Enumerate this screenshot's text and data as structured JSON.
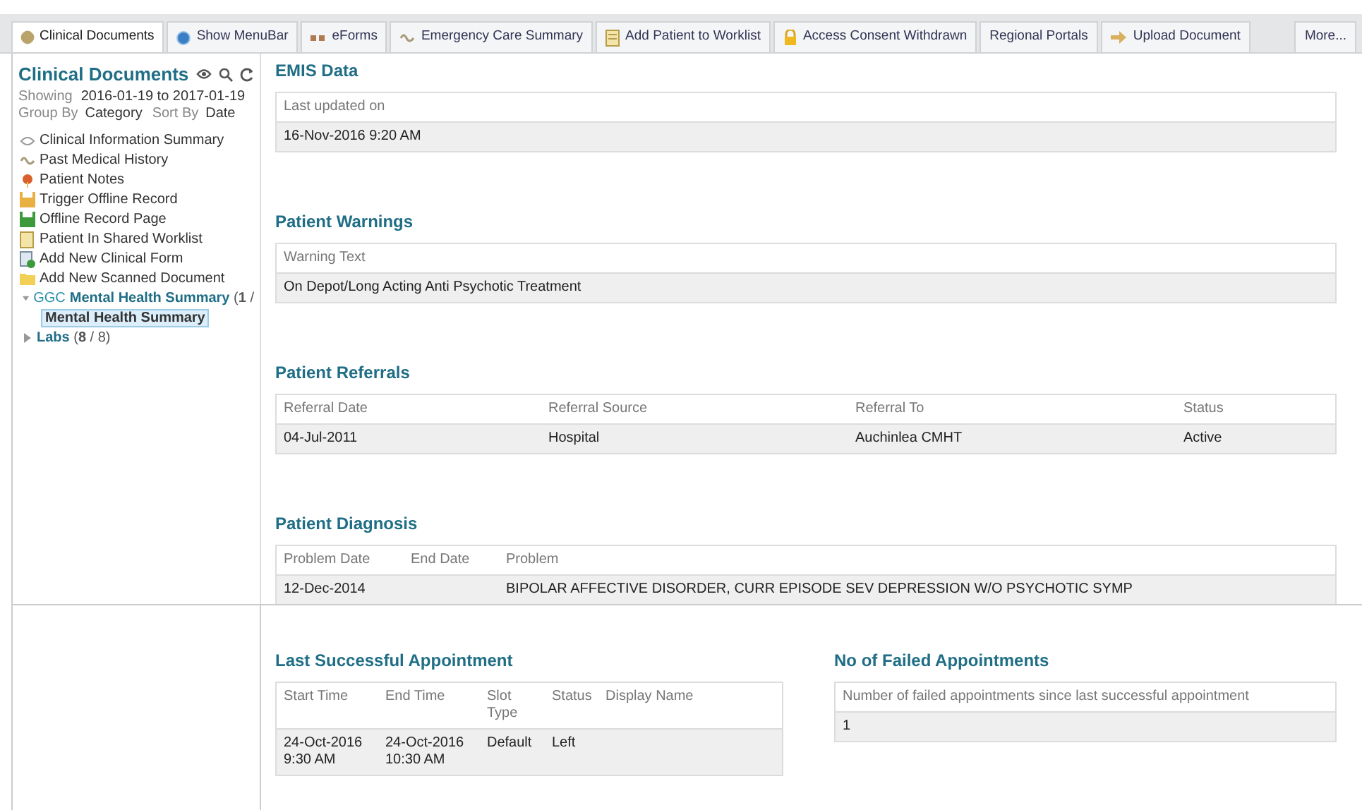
{
  "tabs": [
    {
      "label": "Clinical Documents",
      "selected": true
    },
    {
      "label": "Show MenuBar",
      "selected": false
    },
    {
      "label": "eForms",
      "selected": false
    },
    {
      "label": "Emergency Care Summary",
      "selected": false
    },
    {
      "label": "Add Patient to Worklist",
      "selected": false
    },
    {
      "label": "Access Consent Withdrawn",
      "selected": false
    },
    {
      "label": "Regional Portals",
      "selected": false
    },
    {
      "label": "Upload Document",
      "selected": false
    },
    {
      "label": "More...",
      "selected": false
    }
  ],
  "sidebar": {
    "title": "Clinical Documents",
    "showing_label": "Showing",
    "showing_range": "2016-01-19 to 2017-01-19",
    "group_by_label": "Group By",
    "group_by_value": "Category",
    "sort_by_label": "Sort By",
    "sort_by_value": "Date",
    "items": [
      {
        "label": "Clinical Information Summary"
      },
      {
        "label": "Past Medical History"
      },
      {
        "label": "Patient Notes"
      },
      {
        "label": "Trigger Offline Record"
      },
      {
        "label": "Offline Record Page"
      },
      {
        "label": "Patient In Shared Worklist"
      },
      {
        "label": "Add New Clinical Form"
      },
      {
        "label": "Add New Scanned Document"
      }
    ],
    "tree": [
      {
        "prefix": "GGC",
        "label": "Mental Health Summary",
        "count": "(**1** /",
        "expanded": true,
        "selected": false,
        "children": [
          {
            "label": "Mental Health Summary",
            "selected": true
          }
        ]
      },
      {
        "label": "Labs",
        "count": "(**8** / 8)",
        "expanded": false,
        "selected": false
      }
    ]
  },
  "sections": [
    {
      "title": "EMIS Data",
      "columns": [
        "Last updated on"
      ],
      "rows": [
        [
          "16-Nov-2016 9:20 AM"
        ]
      ]
    },
    {
      "title": "Patient Warnings",
      "columns": [
        "Warning Text"
      ],
      "rows": [
        [
          "On Depot/Long Acting Anti Psychotic Treatment"
        ]
      ]
    },
    {
      "title": "Patient Referrals",
      "columns": [
        "Referral Date",
        "Referral Source",
        "Referral To",
        "Status"
      ],
      "rows": [
        [
          "04-Jul-2011",
          "Hospital",
          "Auchinlea CMHT",
          "Active"
        ]
      ]
    },
    {
      "title": "Patient Diagnosis",
      "columns": [
        "Problem Date",
        "End Date",
        "Problem"
      ],
      "rows": [
        [
          "12-Dec-2014",
          "",
          "BIPOLAR AFFECTIVE DISORDER, CURR EPISODE SEV DEPRESSION W/O PSYCHOTIC SYMP"
        ]
      ]
    }
  ],
  "bottom_sections": [
    {
      "title": "Last Successful Appointment",
      "columns": [
        "Start Time",
        "End Time",
        "Slot Type",
        "Status",
        "Display Name"
      ],
      "rows": [
        [
          "24-Oct-2016 9:30 AM",
          "24-Oct-2016 10:30 AM",
          "Default",
          "Left",
          ""
        ]
      ]
    },
    {
      "title": "No of Failed Appointments",
      "columns": [
        "Number of failed appointments since last successful appointment"
      ],
      "rows": [
        [
          "1"
        ]
      ]
    }
  ]
}
